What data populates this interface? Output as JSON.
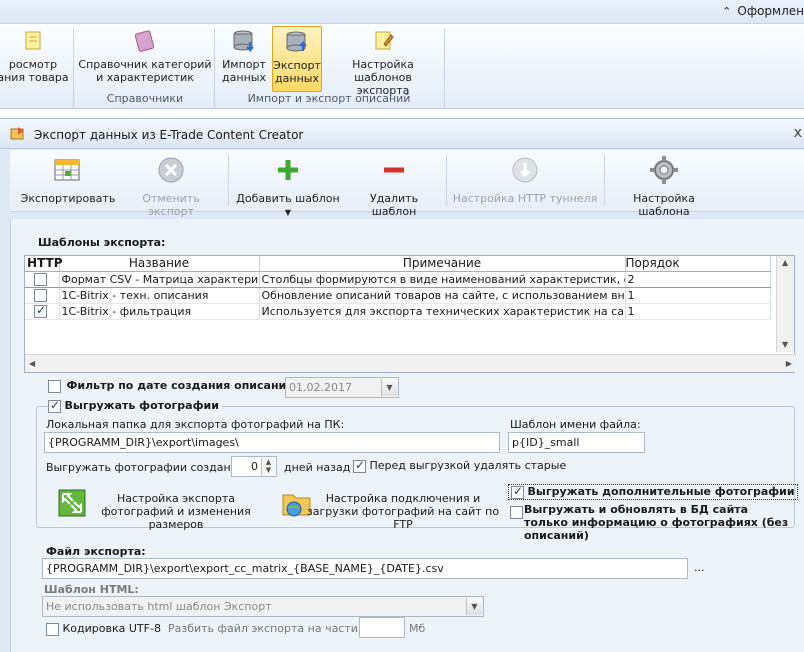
{
  "ribbon": {
    "tab_format": "Оформлен",
    "buttons": [
      {
        "label1": "росмотр",
        "label2": "ания товара"
      },
      {
        "label1": "Справочник категорий",
        "label2": "и характеристик"
      },
      {
        "label1": "Импорт",
        "label2": "данных"
      },
      {
        "label1": "Экспорт",
        "label2": "данных"
      },
      {
        "label1": "Настройка",
        "label2": "шаблонов экспорта"
      }
    ],
    "groups": {
      "references": "Справочники",
      "import_export": "Импорт и экспорт описаний"
    }
  },
  "window": {
    "title": "Экспорт данных из E-Trade Content Creator",
    "close": "x"
  },
  "toolbar": {
    "export": "Экспортировать",
    "cancel_export": "Отменить экспорт",
    "add_template": "Добавить шаблон",
    "delete_template": "Удалить шаблон",
    "http_tunnel": "Настройка HTTP туннеля",
    "template_settings": "Настройка шаблона"
  },
  "templates": {
    "label": "Шаблоны экспорта:",
    "columns": {
      "http": "HTTP",
      "name": "Название",
      "note": "Примечание",
      "order": "Порядок"
    },
    "rows": [
      {
        "checked": false,
        "name": "Формат CSV - Матрица характеристик",
        "note": "Столбцы формируются в виде наименований характеристик, строки",
        "order": "2"
      },
      {
        "checked": false,
        "name": "1C-Bitrix - техн. описания",
        "note": "Обновление описаний товаров на сайте, с использованием внешнего",
        "order": "1"
      },
      {
        "checked": true,
        "name": "1C-Bitrix - фильтрация",
        "note": "Используется для экспорта технических характеристик на сайт для с",
        "order": "1"
      }
    ]
  },
  "filter_date": {
    "label": "Фильтр по дате создания описаний",
    "value": "01.02.2017",
    "checked": false
  },
  "photos": {
    "export_label": "Выгружать фотографии",
    "export_checked": true,
    "folder_label": "Локальная папка для экспорта фотографий на ПК:",
    "folder_value": "{PROGRAMM_DIR}\\export\\images\\",
    "filename_label": "Шаблон имени файла:",
    "filename_value": "p{ID}_small",
    "created_label": "Выгружать фотографии созданные",
    "days_value": "0",
    "days_suffix": "дней назад",
    "delete_old_label": "Перед выгрузкой удалять старые",
    "delete_old_checked": true,
    "resize_settings": "Настройка экспорта фотографий и изменения размеров",
    "ftp_settings": "Настройка подключения и загрузки фотографий на сайт по FTP",
    "extra_photos_label": "Выгружать дополнительные фотографии",
    "extra_photos_checked": true,
    "update_db_label": "Выгружать и обновлять в БД сайта только информацию о фотографиях (без описаний)",
    "update_db_checked": false
  },
  "export_file": {
    "label": "Файл экспорта:",
    "value": "{PROGRAMM_DIR}\\export\\export_cc_matrix_{BASE_NAME}_{DATE}.csv",
    "browse": "..."
  },
  "html_template": {
    "label": "Шаблон HTML:",
    "value": "Не использовать html шаблон Экспорт"
  },
  "encoding": {
    "label": "Кодировка UTF-8",
    "checked": false
  },
  "split": {
    "label": "Разбить файл экспорта на части, по:",
    "value": "",
    "unit": "Мб"
  }
}
